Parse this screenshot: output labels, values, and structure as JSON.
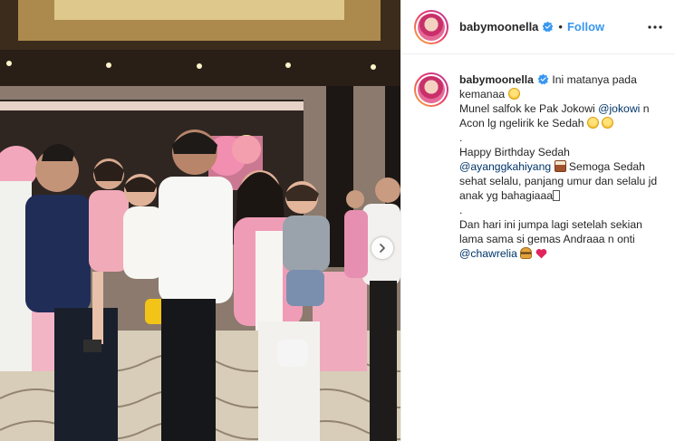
{
  "post": {
    "username": "babymoonella",
    "follow_label": "Follow",
    "separator": "•"
  },
  "caption": {
    "username": "babymoonella",
    "line1": "Ini matanya pada kemanaa",
    "line2_pre": "Munel salfok ke Pak Jokowi ",
    "mention_jokowi": "@jokowi",
    "line2_post": " n Acon lg ngelirik ke Sedah",
    "dot1": ".",
    "line3": "Happy Birthday Sedah",
    "mention_ayang": "@ayanggkahiyang",
    "line4_post": " Semoga Sedah sehat selalu, panjang umur dan selalu jd anak yg bahagiaaa",
    "dot2": ".",
    "line5": "Dan hari ini jumpa lagi setelah sekian lama sama si gemas Andraaa n onti",
    "mention_chaw": "@chawrelia"
  },
  "icons": {
    "verified": "verified-badge-icon",
    "more": "more-options-icon",
    "carousel": "chevron-right-icon"
  },
  "colors": {
    "link": "#3897f0",
    "mention": "#003569",
    "text": "#262626",
    "border": "#efefef"
  }
}
